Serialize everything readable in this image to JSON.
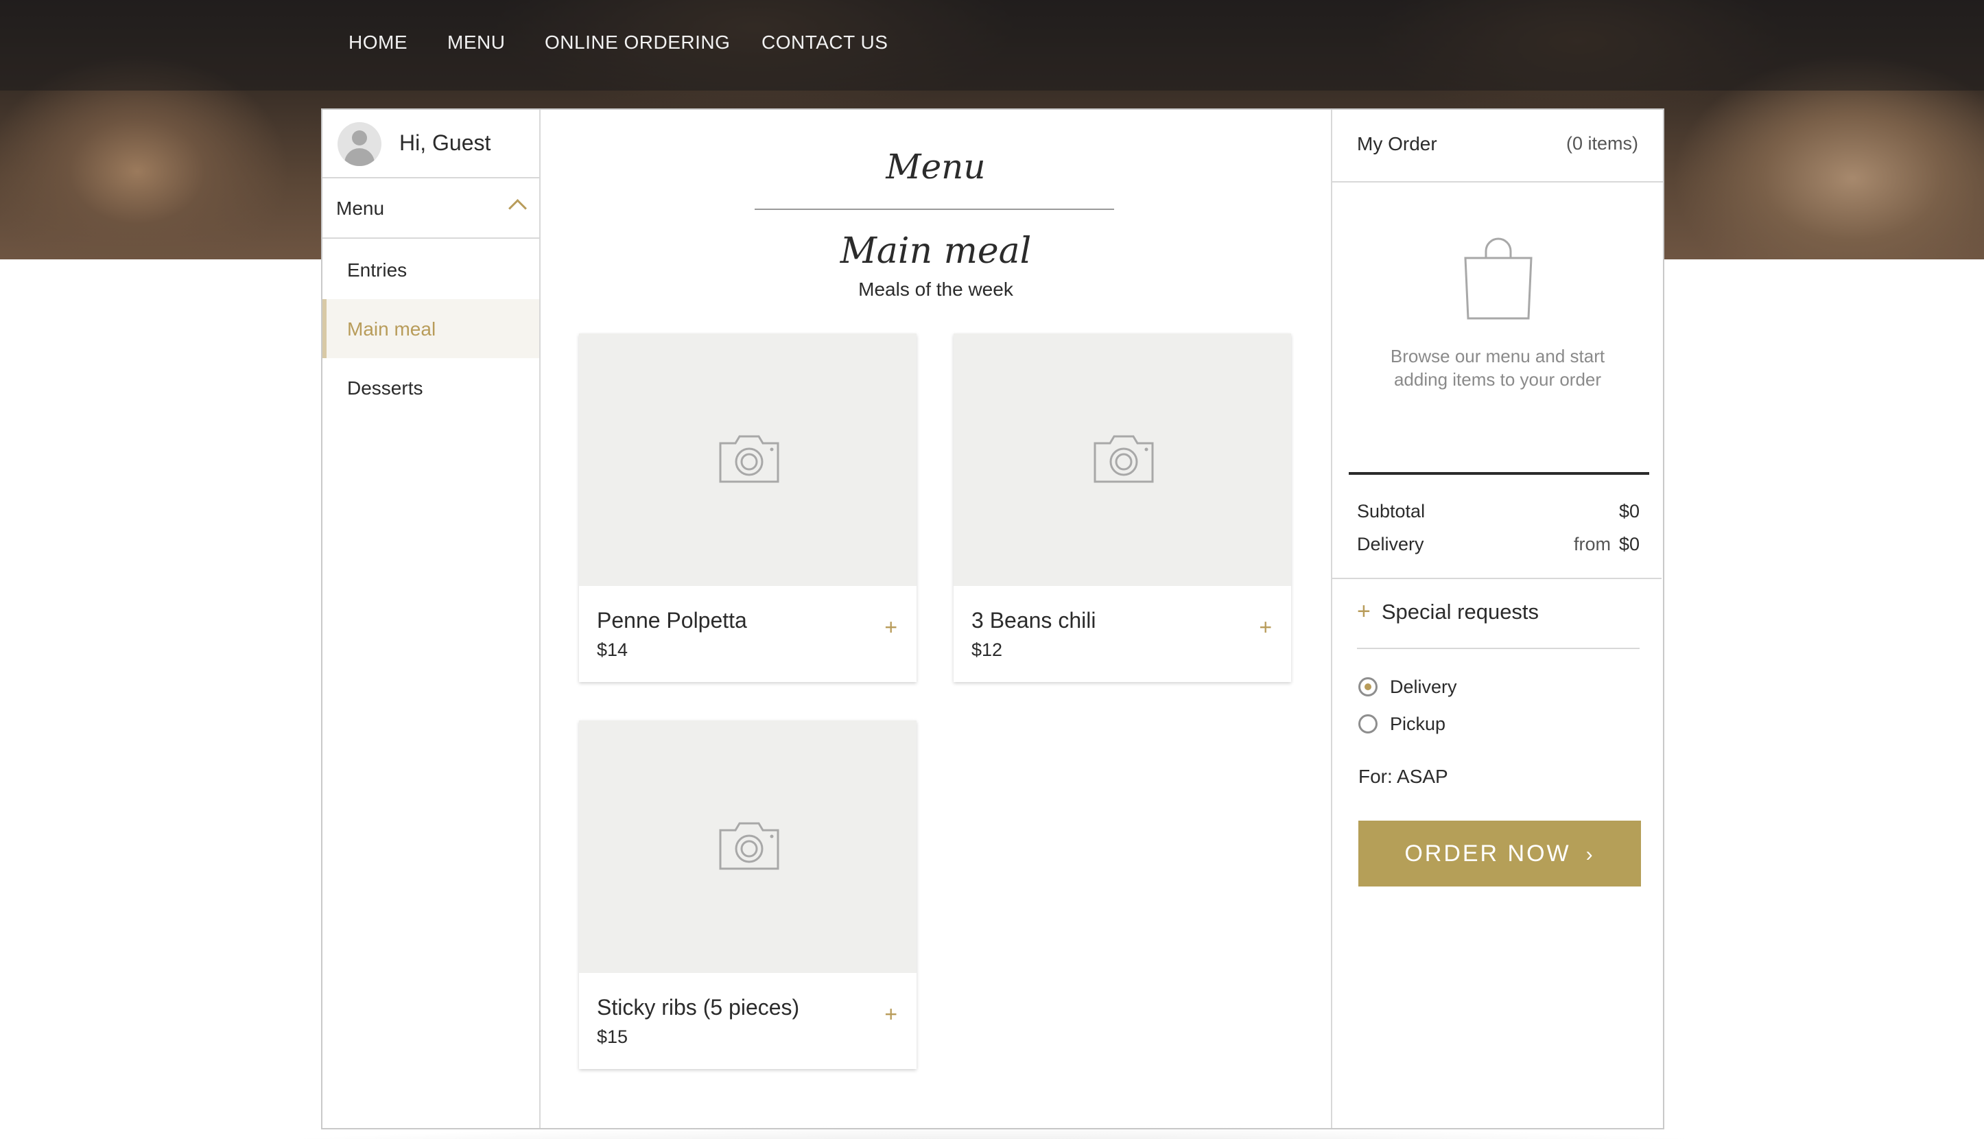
{
  "nav": {
    "items": [
      {
        "label": "HOME"
      },
      {
        "label": "MENU"
      },
      {
        "label": "ONLINE ORDERING"
      },
      {
        "label": "CONTACT US"
      }
    ]
  },
  "sidebar": {
    "greeting": "Hi, Guest",
    "menu_label": "Menu",
    "categories": [
      {
        "label": "Entries",
        "active": false
      },
      {
        "label": "Main meal",
        "active": true
      },
      {
        "label": "Desserts",
        "active": false
      }
    ]
  },
  "content": {
    "menu_title": "Menu",
    "section_title": "Main meal",
    "section_subtitle": "Meals of the week",
    "items": [
      {
        "name": "Penne Polpetta",
        "price": "$14",
        "add": "+"
      },
      {
        "name": "3 Beans chili",
        "price": "$12",
        "add": "+"
      },
      {
        "name": "Sticky ribs (5 pieces)",
        "price": "$15",
        "add": "+"
      }
    ]
  },
  "order": {
    "title": "My Order",
    "count": "(0 items)",
    "empty_message": "Browse our menu and start adding items to your order",
    "subtotal_label": "Subtotal",
    "subtotal_value": "$0",
    "delivery_label": "Delivery",
    "delivery_from": "from",
    "delivery_value": "$0",
    "special_requests": "Special requests",
    "options": [
      {
        "label": "Delivery",
        "selected": true
      },
      {
        "label": "Pickup",
        "selected": false
      }
    ],
    "for_label": "For: ASAP",
    "button_label": "ORDER NOW",
    "button_chevron": "›"
  },
  "colors": {
    "accent": "#b59f58",
    "active_bg": "#f6f4ef"
  }
}
